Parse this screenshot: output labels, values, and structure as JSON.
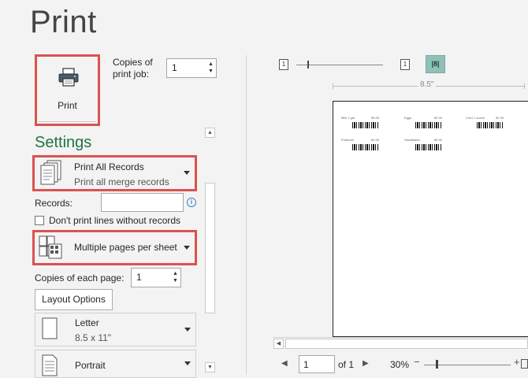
{
  "title": "Print",
  "print_button": {
    "label": "Print",
    "icon": "printer-icon"
  },
  "copies_print_job": {
    "label_line1": "Copies of",
    "label_line2": "print job:",
    "value": "1"
  },
  "settings": {
    "heading": "Settings",
    "records_dropdown": {
      "main": "Print All Records",
      "sub": "Print all merge records",
      "icon": "document-stack-icon"
    },
    "records_field": {
      "label": "Records:",
      "value": ""
    },
    "checkbox": {
      "label": "Don't print lines without records",
      "checked": false
    },
    "pages_dropdown": {
      "main": "Multiple pages per sheet",
      "icon": "multiple-pages-icon"
    },
    "copies_each_page": {
      "label": "Copies of each page:",
      "value": "1"
    },
    "layout_button": "Layout Options",
    "paper_dropdown": {
      "main": "Letter",
      "sub": "8.5 x 11\""
    },
    "orientation_dropdown": {
      "main": "Portrait"
    }
  },
  "preview": {
    "ruler_label": "8.5\"",
    "zoom_to_page_icon": "1",
    "margins_icon": "8",
    "labels": [
      {
        "name": "Milk 1 gal",
        "price": "$3.99"
      },
      {
        "name": "Eggs",
        "price": "$2.99"
      },
      {
        "name": "Corn 1 ounce",
        "price": "$1.99"
      },
      {
        "name": "Potatoes",
        "price": "$1.99"
      },
      {
        "name": "Sandflakes",
        "price": "$2.99"
      }
    ],
    "page_current": "1",
    "page_of": "of 1",
    "zoom": "30%"
  }
}
